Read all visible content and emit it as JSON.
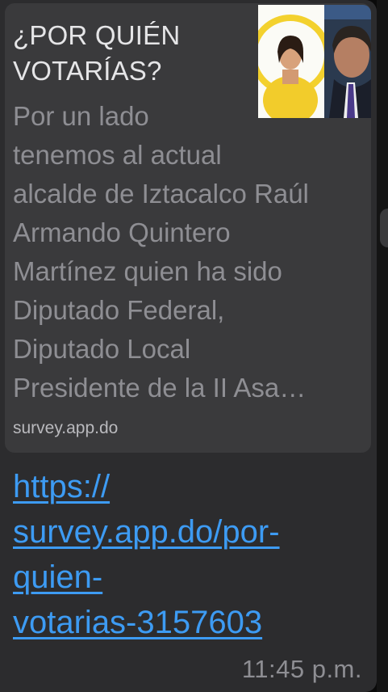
{
  "message": {
    "preview": {
      "title": "¿POR QUIÉN VOTARÍAS?",
      "description": "Por un lado\ntenemos al actual\nalcalde de Iztacalco Raúl\nArmando Quintero\nMartínez quien ha sido\nDiputado Federal,\nDiputado Local\nPresidente de la II Asa…",
      "domain": "survey.app.do"
    },
    "link": "https://\nsurvey.app.do/por-\nquien-\nvotarias-3157603",
    "timestamp": "11:45 p.m."
  },
  "colors": {
    "bubble": "#2c2c2e",
    "card": "#3a3a3c",
    "link": "#3d9bf3",
    "timestamp": "#8e8e93"
  }
}
